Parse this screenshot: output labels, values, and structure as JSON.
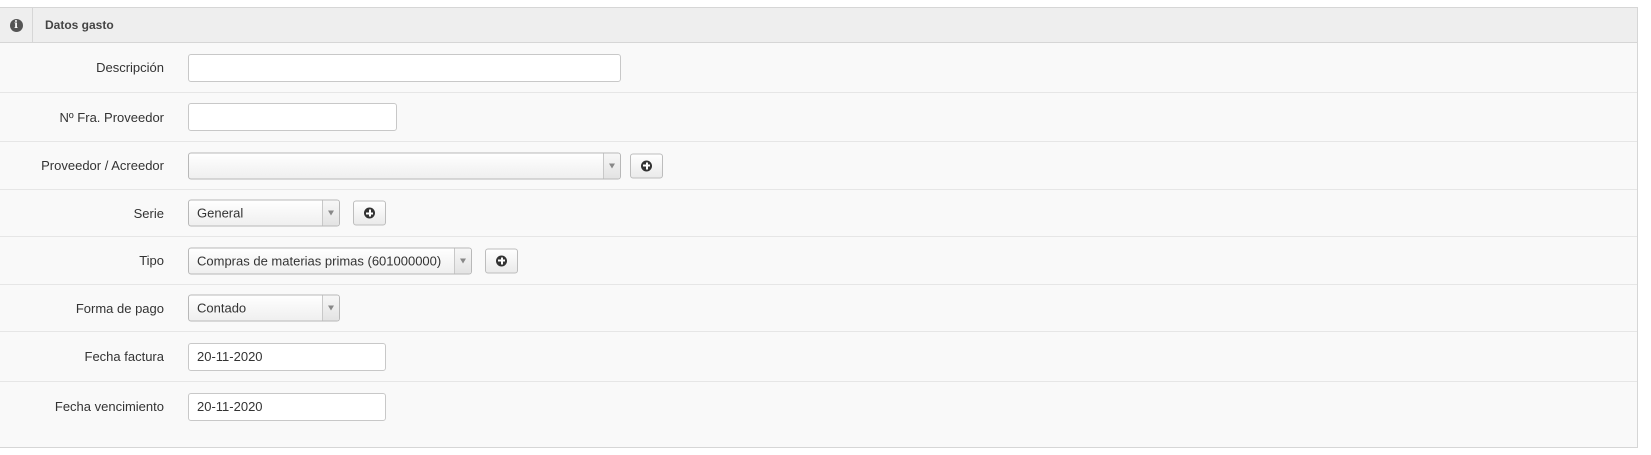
{
  "panel": {
    "title": "Datos gasto",
    "header_icon": "info-icon"
  },
  "form": {
    "descripcion": {
      "label": "Descripción",
      "value": ""
    },
    "num_factura": {
      "label": "Nº Fra. Proveedor",
      "value": ""
    },
    "proveedor": {
      "label": "Proveedor / Acreedor",
      "value": "",
      "add_icon": "plus-circle-icon"
    },
    "serie": {
      "label": "Serie",
      "value": "General",
      "add_icon": "plus-circle-icon"
    },
    "tipo": {
      "label": "Tipo",
      "value": "Compras de materias primas (601000000)",
      "add_icon": "plus-circle-icon"
    },
    "forma_pago": {
      "label": "Forma de pago",
      "value": "Contado"
    },
    "fecha_factura": {
      "label": "Fecha factura",
      "value": "20-11-2020"
    },
    "fecha_vencimiento": {
      "label": "Fecha vencimiento",
      "value": "20-11-2020"
    }
  }
}
